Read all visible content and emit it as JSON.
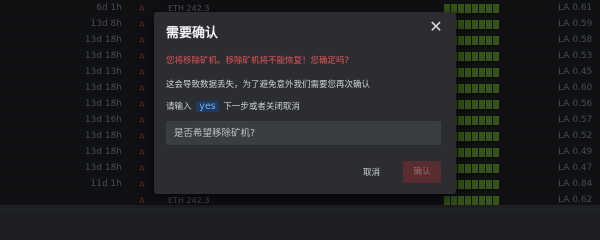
{
  "background_rows": [
    {
      "time": "6d 1h",
      "alert": "A",
      "coin": "ETH 242.3",
      "bars": 8,
      "load": "LA 0.61"
    },
    {
      "time": "13d 8h",
      "alert": "A",
      "coin": "",
      "bars": 8,
      "load": "LA 0.59"
    },
    {
      "time": "13d 18h",
      "alert": "A",
      "coin": "",
      "bars": 8,
      "load": "LA 0.58"
    },
    {
      "time": "13d 18h",
      "alert": "A",
      "coin": "",
      "bars": 8,
      "load": "LA 0.53"
    },
    {
      "time": "13d 13h",
      "alert": "A",
      "coin": "",
      "bars": 8,
      "load": "LA 0.45"
    },
    {
      "time": "13d 18h",
      "alert": "A",
      "coin": "",
      "bars": 8,
      "load": "LA 0.60"
    },
    {
      "time": "13d 18h",
      "alert": "A",
      "coin": "",
      "bars": 8,
      "load": "LA 0.56"
    },
    {
      "time": "13d 16h",
      "alert": "A",
      "coin": "",
      "bars": 8,
      "load": "LA 0.57"
    },
    {
      "time": "13d 18h",
      "alert": "A",
      "coin": "",
      "bars": 8,
      "load": "LA 0.52"
    },
    {
      "time": "13d 18h",
      "alert": "A",
      "coin": "",
      "bars": 8,
      "load": "LA 0.49"
    },
    {
      "time": "13d 18h",
      "alert": "A",
      "coin": "",
      "bars": 8,
      "load": "LA 0.47"
    },
    {
      "time": "11d 1h",
      "alert": "A",
      "coin": "",
      "bars": 8,
      "load": "LA 0.84"
    },
    {
      "time": "",
      "alert": "A",
      "coin": "ETH 242.3",
      "bars": 8,
      "load": "LA 0.62"
    }
  ],
  "modal": {
    "title": "需要确认",
    "close_glyph": "✕",
    "warning": "您将移除矿机。移除矿机将不能恢复！您确定吗?",
    "info": "这会导致数据丢失，为了避免意外我们需要您再次确认",
    "prompt_before": "请输入",
    "keyword": "yes",
    "prompt_after": "下一步或者关闭取消",
    "input": {
      "value": "",
      "placeholder": "是否希望移除矿机?"
    },
    "cancel_label": "取消",
    "ok_label": "确认"
  },
  "colors": {
    "warning": "#e5545a",
    "keyword": "#6fb1f5",
    "ok_button": "#5a2c2f",
    "bar": "#6a9f2c"
  }
}
